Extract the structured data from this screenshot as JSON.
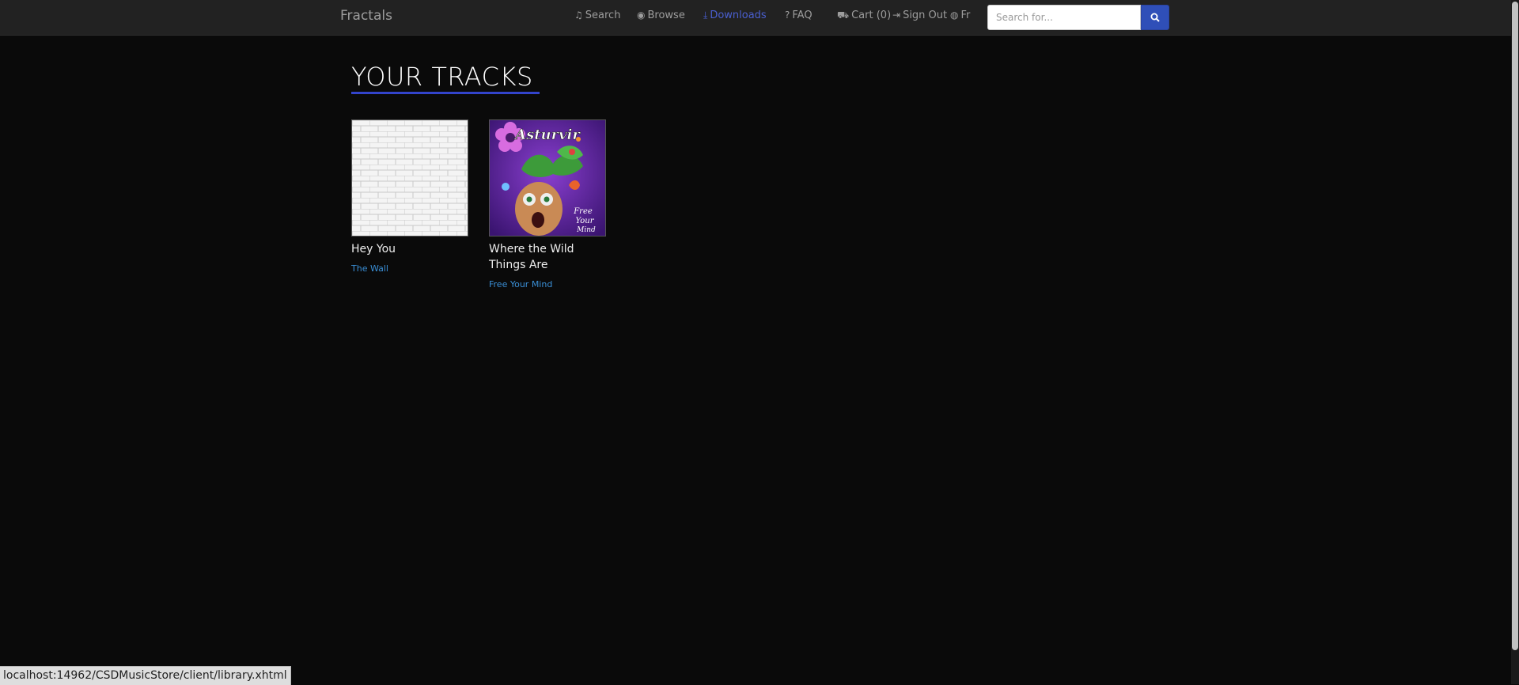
{
  "navbar": {
    "brand": "Fractals",
    "items": [
      {
        "label": "Search",
        "icon": "music-icon"
      },
      {
        "label": "Browse",
        "icon": "eye-icon"
      },
      {
        "label": "Downloads",
        "icon": "download-icon",
        "active": true
      },
      {
        "label": "FAQ",
        "icon": "question-circle-icon"
      },
      {
        "label": "Cart (0)",
        "icon": "cart-icon"
      },
      {
        "label": "Sign Out",
        "icon": "sign-out-icon"
      },
      {
        "label": "Fr",
        "icon": "globe-icon"
      }
    ],
    "search_placeholder": "Search for..."
  },
  "main": {
    "title": "YOUR TRACKS",
    "tracks": [
      {
        "title": "Hey You",
        "album": "The Wall"
      },
      {
        "title": "Where the Wild Things Are",
        "album": "Free Your Mind"
      }
    ]
  },
  "status_bar": {
    "url": "localhost:14962/CSDMusicStore/client/library.xhtml"
  },
  "colors": {
    "accent": "#3344cc",
    "link": "#3a8fd6",
    "navbar_bg": "#222222",
    "page_bg": "#0a0a0a"
  }
}
